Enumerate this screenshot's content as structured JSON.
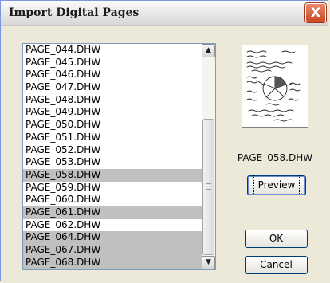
{
  "window": {
    "title": "Import Digital Pages",
    "close_label": "X"
  },
  "list": {
    "items": [
      {
        "name": "PAGE_044.DHW",
        "selected": false
      },
      {
        "name": "PAGE_045.DHW",
        "selected": false
      },
      {
        "name": "PAGE_046.DHW",
        "selected": false
      },
      {
        "name": "PAGE_047.DHW",
        "selected": false
      },
      {
        "name": "PAGE_048.DHW",
        "selected": false
      },
      {
        "name": "PAGE_049.DHW",
        "selected": false
      },
      {
        "name": "PAGE_050.DHW",
        "selected": false
      },
      {
        "name": "PAGE_051.DHW",
        "selected": false
      },
      {
        "name": "PAGE_052.DHW",
        "selected": false
      },
      {
        "name": "PAGE_053.DHW",
        "selected": false
      },
      {
        "name": "PAGE_058.DHW",
        "selected": true
      },
      {
        "name": "PAGE_059.DHW",
        "selected": false
      },
      {
        "name": "PAGE_060.DHW",
        "selected": false
      },
      {
        "name": "PAGE_061.DHW",
        "selected": true
      },
      {
        "name": "PAGE_062.DHW",
        "selected": false
      },
      {
        "name": "PAGE_064.DHW",
        "selected": true
      },
      {
        "name": "PAGE_067.DHW",
        "selected": true
      },
      {
        "name": "PAGE_068.DHW",
        "selected": true
      }
    ]
  },
  "scrollbar": {
    "up_icon": "triangle-up-icon",
    "down_icon": "triangle-down-icon"
  },
  "preview": {
    "filename": "PAGE_058.DHW",
    "button_label": "Preview"
  },
  "buttons": {
    "ok_label": "OK",
    "cancel_label": "Cancel"
  },
  "colors": {
    "selection": "#c0c0c0",
    "dialog_bg": "#ece9d8",
    "close_red": "#cc4a22"
  }
}
